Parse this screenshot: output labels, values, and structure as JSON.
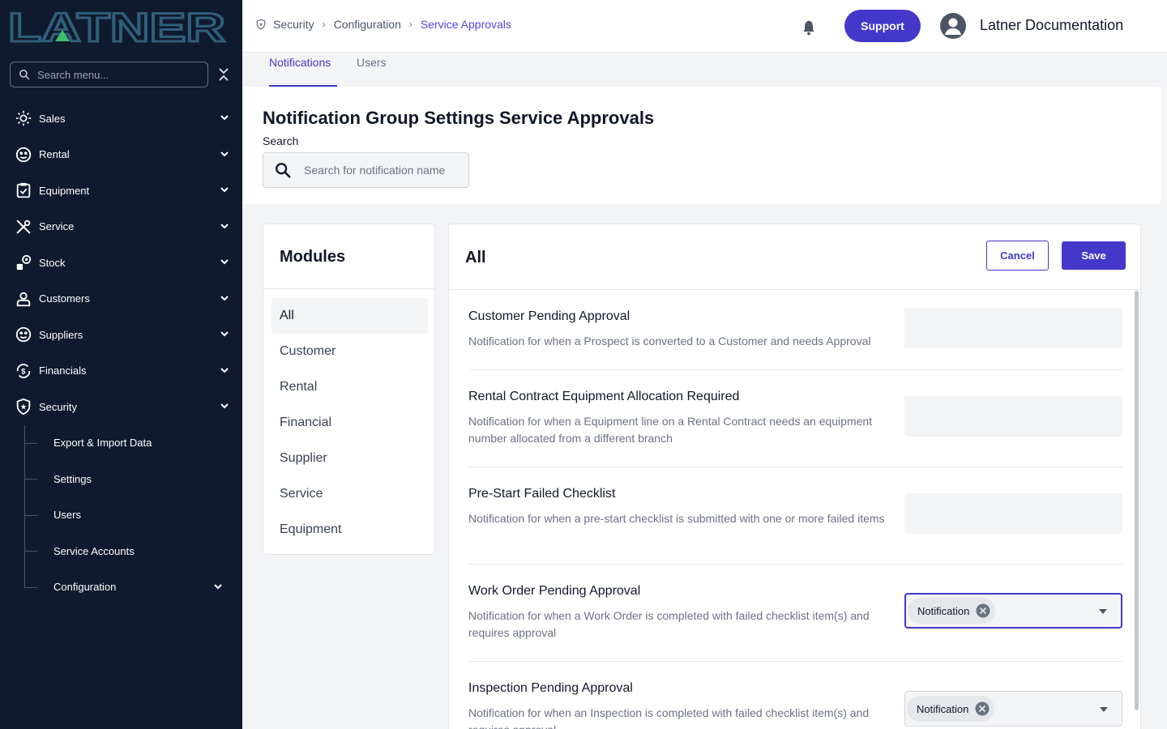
{
  "app": {
    "logo_text": "LATNER",
    "accent_color": "#4338ca"
  },
  "sidebar": {
    "search_placeholder": "Search menu...",
    "items": [
      {
        "label": "Sales",
        "icon": "sales-icon"
      },
      {
        "label": "Rental",
        "icon": "rental-icon"
      },
      {
        "label": "Equipment",
        "icon": "equipment-icon"
      },
      {
        "label": "Service",
        "icon": "service-icon"
      },
      {
        "label": "Stock",
        "icon": "stock-icon"
      },
      {
        "label": "Customers",
        "icon": "customers-icon"
      },
      {
        "label": "Suppliers",
        "icon": "suppliers-icon"
      },
      {
        "label": "Financials",
        "icon": "financials-icon"
      },
      {
        "label": "Security",
        "icon": "security-icon"
      }
    ],
    "security_sub_items": [
      {
        "label": "Export & Import Data"
      },
      {
        "label": "Settings"
      },
      {
        "label": "Users"
      },
      {
        "label": "Service Accounts"
      },
      {
        "label": "Configuration"
      }
    ]
  },
  "topbar": {
    "breadcrumb": [
      "Security",
      "Configuration",
      "Service Approvals"
    ],
    "support_label": "Support",
    "user_name": "Latner Documentation"
  },
  "tabs": [
    {
      "label": "Notifications",
      "active": true
    },
    {
      "label": "Users",
      "active": false
    }
  ],
  "header": {
    "title_prefix": "Notification Group Settings",
    "title_group": "Service Approvals",
    "search_label": "Search",
    "search_placeholder": "Search for notification name",
    "search_value": ""
  },
  "modules": {
    "title": "Modules",
    "items": [
      "All",
      "Customer",
      "Rental",
      "Financial",
      "Supplier",
      "Service",
      "Equipment"
    ],
    "selected": "All"
  },
  "main": {
    "title": "All",
    "cancel_label": "Cancel",
    "save_label": "Save",
    "notifications": [
      {
        "title": "Customer Pending Approval",
        "description": "Notification for when a Prospect is converted to a Customer and needs Approval",
        "selected": ""
      },
      {
        "title": "Rental Contract Equipment Allocation Required",
        "description": "Notification for when a Equipment line on a Rental Contract needs an equipment number allocated from a different branch",
        "selected": ""
      },
      {
        "title": "Pre-Start Failed Checklist",
        "description": "Notification for when a pre-start checklist is submitted with one or more failed items",
        "selected": ""
      },
      {
        "title": "Work Order Pending Approval",
        "description": "Notification for when a Work Order is completed with failed checklist item(s) and requires approval",
        "selected": "Notification"
      },
      {
        "title": "Inspection Pending Approval",
        "description": "Notification for when an Inspection is completed with failed checklist item(s) and requires approval",
        "selected": "Notification"
      }
    ]
  }
}
